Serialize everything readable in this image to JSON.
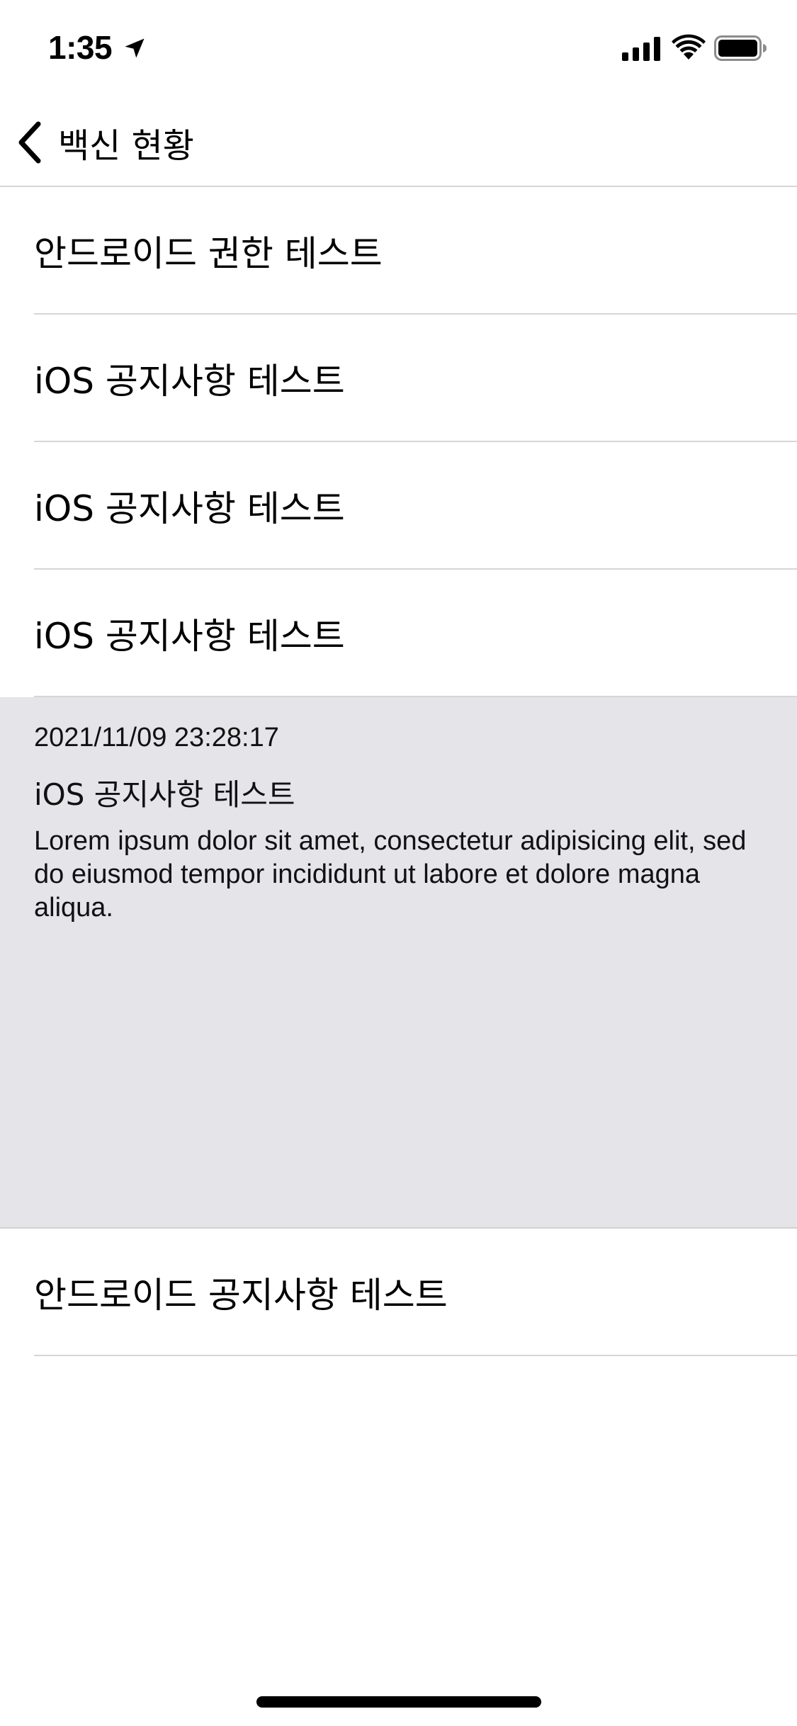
{
  "status_bar": {
    "time": "1:35"
  },
  "nav": {
    "back_label": "백신 현황"
  },
  "list": {
    "items": [
      {
        "title": "안드로이드 권한 테스트"
      },
      {
        "title": "iOS 공지사항 테스트"
      },
      {
        "title": "iOS 공지사항 테스트"
      },
      {
        "title": "iOS 공지사항 테스트"
      }
    ],
    "expanded_item": {
      "date": "2021/11/09 23:28:17",
      "title": "iOS 공지사항 테스트",
      "body": "Lorem ipsum dolor sit amet, consectetur adipisicing elit, sed do eiusmod tempor incididunt ut labore et dolore magna aliqua."
    },
    "last_item": {
      "title": "안드로이드 공지사항 테스트"
    }
  },
  "colors": {
    "expanded_background": "#e4e4e9",
    "separator": "#d6d6d8",
    "text": "#000000"
  },
  "icons": [
    "location-arrow-icon",
    "cellular-signal-icon",
    "wifi-icon",
    "battery-icon",
    "chevron-left-icon"
  ]
}
